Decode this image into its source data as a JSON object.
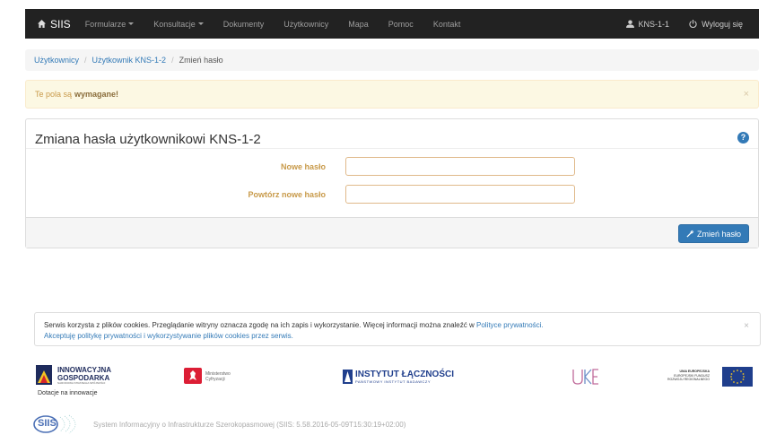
{
  "nav": {
    "brand": "SIIS",
    "items": [
      {
        "label": "Formularze",
        "dropdown": true
      },
      {
        "label": "Konsultacje",
        "dropdown": true
      },
      {
        "label": "Dokumenty",
        "dropdown": false
      },
      {
        "label": "Użytkownicy",
        "dropdown": false
      },
      {
        "label": "Mapa",
        "dropdown": false
      },
      {
        "label": "Pomoc",
        "dropdown": false
      },
      {
        "label": "Kontakt",
        "dropdown": false
      }
    ],
    "user": "KNS-1-1",
    "logout": "Wyloguj się"
  },
  "breadcrumb": {
    "items": [
      "Użytkownicy",
      "Użytkownik KNS-1-2"
    ],
    "active": "Zmień hasło"
  },
  "alert": {
    "text": "Te pola są",
    "emphasis": "wymagane!",
    "close": "×"
  },
  "panel": {
    "title": "Zmiana hasła użytkownikowi KNS-1-2",
    "help": "?",
    "fields": [
      {
        "label": "Nowe hasło",
        "value": ""
      },
      {
        "label": "Powtórz nowe hasło",
        "value": ""
      }
    ],
    "submit": "Zmień hasło"
  },
  "cookie": {
    "text": "Serwis korzysta z plików cookies. Przeglądanie witryny oznacza zgodę na ich zapis i wykorzystanie. Więcej informacji można znaleźć w",
    "policy_link": "Polityce prywatności.",
    "accept": "Akceptuję politykę prywatności i wykorzystywanie plików cookies przez serwis.",
    "close": "×"
  },
  "logos": {
    "ig_line1": "INNOWACYJNA",
    "ig_line2": "GOSPODARKA",
    "ig_line3": "NARODOWA STRATEGIA SPÓJNOŚCI",
    "ig_sub": "Dotacje na innowacje",
    "ministry": "Ministerstwo Cyfryzacji",
    "il_name": "INSTYTUT ŁĄCZNOŚCI",
    "il_sub": "PAŃSTWOWY INSTYTUT BADAWCZY",
    "uke": "UKE",
    "ue_line1": "UNIA EUROPEJSKA",
    "ue_line2": "EUROPEJSKI FUNDUSZ",
    "ue_line3": "ROZWOJU REGIONALNEGO"
  },
  "footer": {
    "logo": "SIIS",
    "text": "System Informacyjny o Infrastrukturze Szerokopasmowej  (SIIS: 5.58.2016-05-09T15:30:19+02:00)"
  },
  "colors": {
    "navbar": "#222222",
    "link": "#337ab7",
    "warning_bg": "#fcf8e3",
    "warning_text": "#8a6d3b",
    "primary": "#337ab7"
  }
}
